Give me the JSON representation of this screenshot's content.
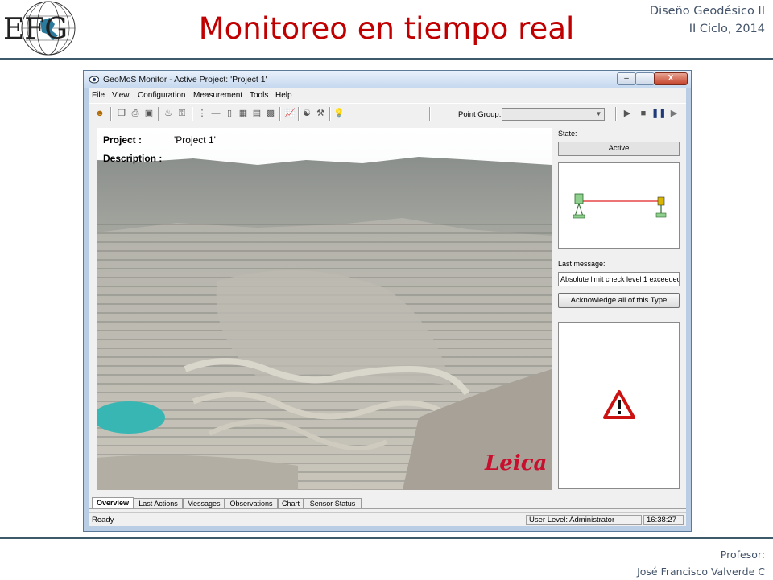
{
  "slide": {
    "logo_text": "EFG",
    "title": "Monitoreo en tiempo real",
    "course_line1": "Diseño Geodésico II",
    "course_line2": "II Ciclo, 2014",
    "professor_label": "Profesor:",
    "professor_name": "José Francisco Valverde C"
  },
  "window": {
    "title": "GeoMoS Monitor - Active Project: 'Project 1'",
    "controls": {
      "minimize": "–",
      "maximize": "□",
      "close": "X"
    }
  },
  "menu": [
    "File",
    "View",
    "Configuration",
    "Measurement",
    "Tools",
    "Help"
  ],
  "toolbar": {
    "point_group_label": "Point Group:",
    "point_group_value": ""
  },
  "overview": {
    "project_label": "Project :",
    "project_value": "'Project 1'",
    "description_label": "Description :",
    "description_value": "",
    "brand_watermark": "Leica"
  },
  "panel": {
    "state_label": "State:",
    "state_value": "Active",
    "last_message_label": "Last message:",
    "last_message_value": "Absolute limit check level 1 exceeded! (",
    "acknowledge_button": "Acknowledge all of this Type",
    "alert_icon": "warning-triangle-icon"
  },
  "tabs": [
    "Overview",
    "Last Actions",
    "Messages",
    "Observations",
    "Chart",
    "Sensor Status"
  ],
  "active_tab": "Overview",
  "status": {
    "ready": "Ready",
    "user_level": "User Level: Administrator",
    "time": "16:38:27"
  },
  "colors": {
    "title_red": "#c00000",
    "rule": "#3c5a6a",
    "window_frame": "#b9cde5",
    "alert_red": "#cc1111"
  }
}
